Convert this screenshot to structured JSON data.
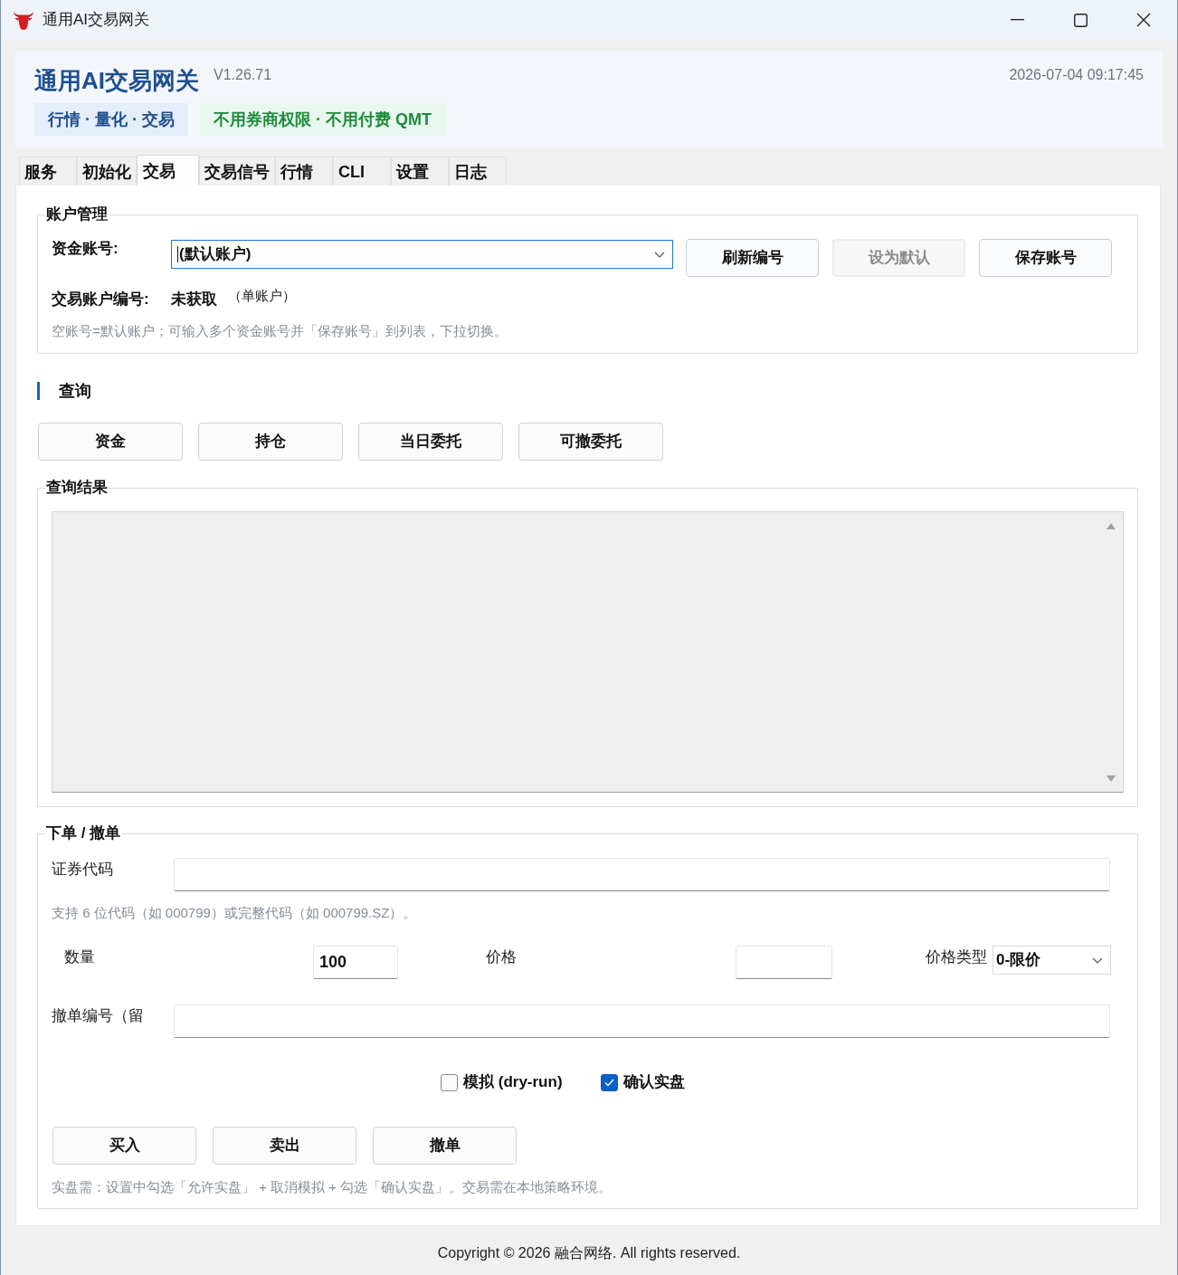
{
  "window": {
    "title": "通用AI交易网关"
  },
  "header": {
    "title": "通用AI交易网关",
    "version": "V1.26.71",
    "datetime": "2026-07-04 09:17:45",
    "badges": [
      {
        "label": "行情 · 量化 · 交易",
        "kind": "info"
      },
      {
        "label": "不用券商权限 · 不用付费 QMT",
        "kind": "success"
      }
    ]
  },
  "tabs": [
    {
      "label": "服务",
      "selected": false
    },
    {
      "label": "初始化",
      "selected": false
    },
    {
      "label": "交易",
      "selected": true
    },
    {
      "label": "交易信号",
      "selected": false
    },
    {
      "label": "行情",
      "selected": false
    },
    {
      "label": "CLI",
      "selected": false
    },
    {
      "label": "设置",
      "selected": false
    },
    {
      "label": "日志",
      "selected": false
    }
  ],
  "account": {
    "title": "账户管理",
    "fund_account": {
      "label": "资金账号:",
      "value": "(默认账户)"
    },
    "buttons": [
      {
        "label": "刷新编号",
        "disabled": false
      },
      {
        "label": "设为默认",
        "disabled": true
      },
      {
        "label": "保存账号",
        "disabled": false
      }
    ],
    "trade_account": {
      "label": "交易账户编号:",
      "value": "未获取",
      "note": "（单账户）"
    },
    "hint": "空账号=默认账户；可输入多个资金账号并「保存账号」到列表，下拉切换。"
  },
  "query": {
    "title": "查询",
    "buttons": [
      "资金",
      "持仓",
      "当日委托",
      "可撤委托"
    ]
  },
  "results": {
    "title": "查询结果"
  },
  "order": {
    "title": "下单 / 撤单",
    "code": {
      "label": "证券代码"
    },
    "code_hint": "支持 6 位代码（如 000799）或完整代码（如 000799.SZ）。",
    "quantity": {
      "label": "数量",
      "value": "100"
    },
    "price": {
      "label": "价格"
    },
    "price_type": {
      "label": "价格类型",
      "value": "0-限价"
    },
    "cancel_id": {
      "label": "撤单编号（留"
    },
    "checkboxes": [
      {
        "label": "模拟 (dry-run)",
        "checked": false
      },
      {
        "label": "确认实盘",
        "checked": true
      }
    ],
    "buttons": [
      "买入",
      "卖出",
      "撤单"
    ],
    "hint": "实盘需：设置中勾选「允许实盘」 + 取消模拟 + 勾选「确认实盘」。交易需在本地策略环境。"
  },
  "footer": "Copyright © 2026 融合网络. All rights reserved."
}
